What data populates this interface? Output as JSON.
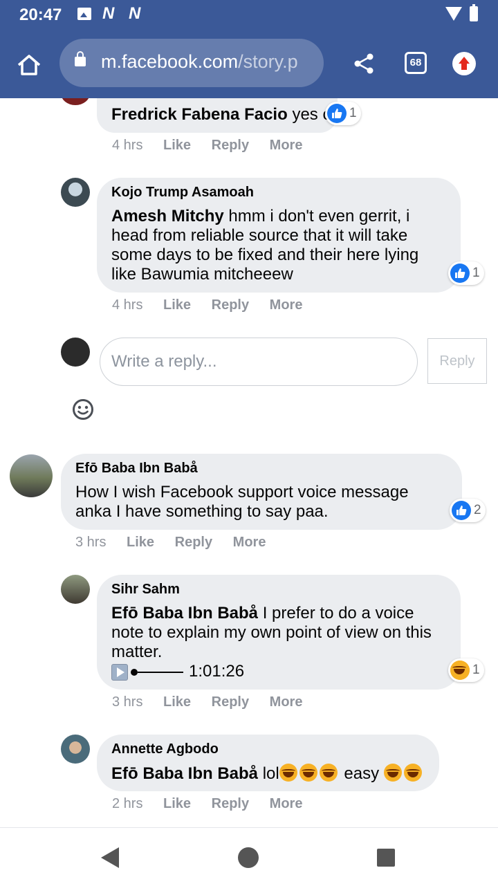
{
  "status_bar": {
    "time": "20:47",
    "notif_1": "N",
    "notif_2": "N"
  },
  "browser": {
    "url_host": "m.facebook.com",
    "url_path": "/story.p",
    "tab_count": "68"
  },
  "comments": [
    {
      "author": "Fredrick Fabena Facio",
      "text": "yes o",
      "time": "4 hrs",
      "reactions": "1"
    },
    {
      "author": "Kojo Trump Asamoah",
      "mention": "Amesh Mitchy",
      "text": " hmm i don't even gerrit, i head from reliable source that it will take some days to be fixed and their here lying like Bawumia mitcheeew",
      "time": "4 hrs",
      "reactions": "1"
    },
    {
      "author": "Efō Baba Ibn Babå",
      "text": "How I wish Facebook support voice message anka I have something to say paa.",
      "time": "3 hrs",
      "reactions": "2"
    },
    {
      "author": "Sihr Sahm",
      "mention": "Efō Baba Ibn Babå",
      "text": " I prefer to do a voice note to explain my own point of view on this matter.",
      "audio_time": "1:01:26",
      "time": "3 hrs",
      "reactions": "1"
    },
    {
      "author": "Annette Agbodo",
      "mention": "Efō Baba Ibn Babå",
      "text_1": " lol",
      "text_2": " easy ",
      "time": "2 hrs"
    }
  ],
  "actions": {
    "like": "Like",
    "reply": "Reply",
    "more": "More"
  },
  "reply_box": {
    "placeholder": "Write a reply...",
    "button": "Reply"
  },
  "colors": {
    "facebook_blue": "#3b5998",
    "bubble": "#ebedf0",
    "like_blue": "#1877f2"
  },
  "icons": [
    "home-icon",
    "lock-icon",
    "share-icon",
    "tabs-icon",
    "update-icon",
    "like-icon",
    "haha-icon",
    "smiley-icon",
    "play-icon",
    "back-icon",
    "home-circle-icon",
    "recents-icon"
  ]
}
